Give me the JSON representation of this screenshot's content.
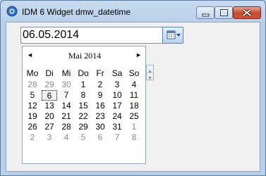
{
  "window": {
    "title": "IDM 6 Widget dmw_datetime"
  },
  "date_field": {
    "value": "06.05.2014"
  },
  "calendar": {
    "month_label": "Mai 2014",
    "prev_symbol": "◄",
    "next_symbol": "►",
    "weekdays": [
      "Mo",
      "Di",
      "Mi",
      "Do",
      "Fr",
      "Sa",
      "So"
    ],
    "weeks": [
      [
        {
          "d": "28",
          "o": true
        },
        {
          "d": "29",
          "o": true
        },
        {
          "d": "30",
          "o": true
        },
        {
          "d": "1"
        },
        {
          "d": "2"
        },
        {
          "d": "3"
        },
        {
          "d": "4"
        }
      ],
      [
        {
          "d": "5"
        },
        {
          "d": "6",
          "sel": true
        },
        {
          "d": "7"
        },
        {
          "d": "8"
        },
        {
          "d": "9"
        },
        {
          "d": "10"
        },
        {
          "d": "11"
        }
      ],
      [
        {
          "d": "12"
        },
        {
          "d": "13"
        },
        {
          "d": "14"
        },
        {
          "d": "15"
        },
        {
          "d": "16"
        },
        {
          "d": "17"
        },
        {
          "d": "18"
        }
      ],
      [
        {
          "d": "19"
        },
        {
          "d": "20"
        },
        {
          "d": "21"
        },
        {
          "d": "22"
        },
        {
          "d": "23"
        },
        {
          "d": "24"
        },
        {
          "d": "25"
        }
      ],
      [
        {
          "d": "26"
        },
        {
          "d": "27"
        },
        {
          "d": "28"
        },
        {
          "d": "29"
        },
        {
          "d": "30"
        },
        {
          "d": "31"
        },
        {
          "d": "1",
          "o": true
        }
      ],
      [
        {
          "d": "2",
          "o": true
        },
        {
          "d": "3",
          "o": true
        },
        {
          "d": "4",
          "o": true
        },
        {
          "d": "5",
          "o": true
        },
        {
          "d": "6",
          "o": true
        },
        {
          "d": "7",
          "o": true
        },
        {
          "d": "8",
          "o": true
        }
      ]
    ]
  },
  "icons": {
    "app": "app-icon",
    "date_button": "calendar-dropdown-icon",
    "spin_up": "arrow-up-icon",
    "spin_down": "arrow-down-icon"
  },
  "colors": {
    "title_bar": "#b9d1ea",
    "close_button": "#c7492e",
    "other_month_day": "#8a8a8a"
  }
}
